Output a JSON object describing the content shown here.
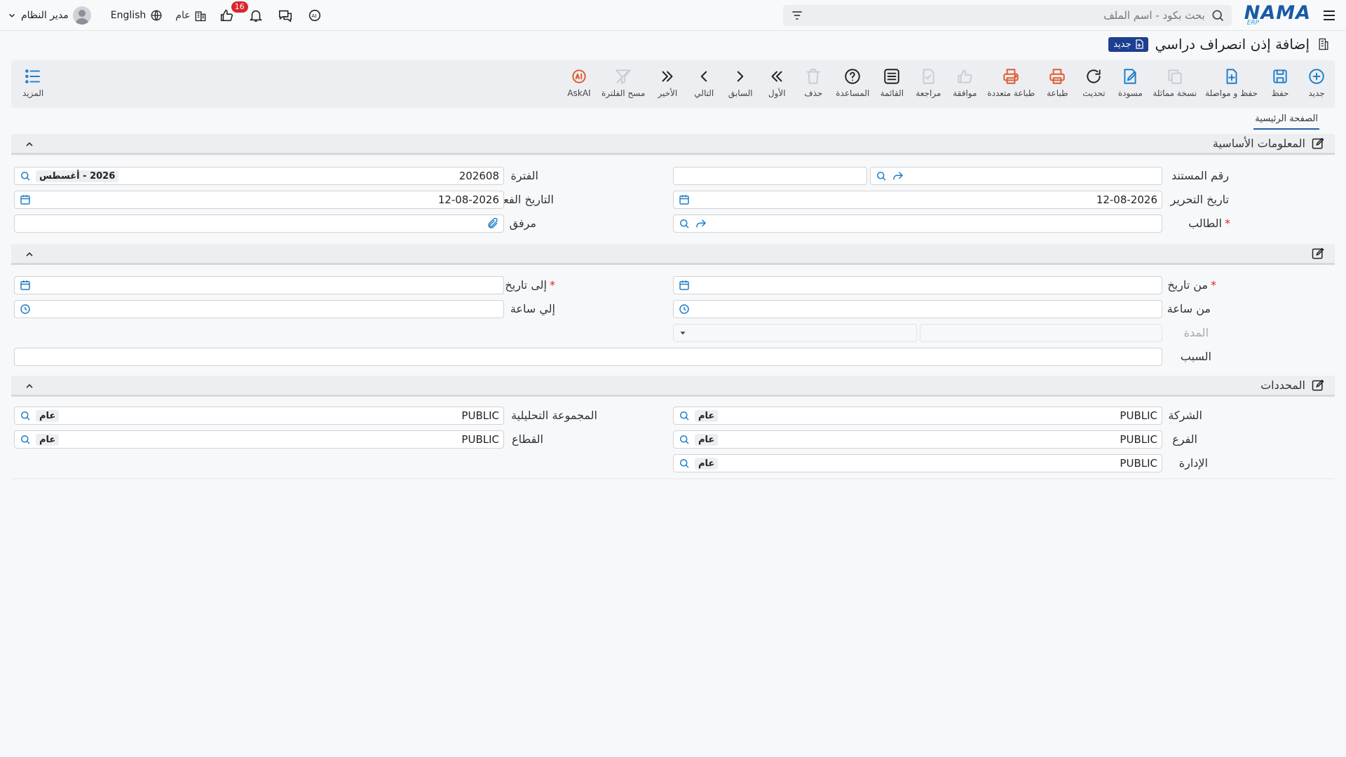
{
  "header": {
    "search_placeholder": "بحث بكود - اسم الملف",
    "logo_main": "NAMA",
    "logo_sub": "ERP",
    "user_name": "مدير النظام",
    "language": "English",
    "scope_label": "عام",
    "notification_count": "16"
  },
  "page": {
    "title": "إضافة إذن انصراف دراسي",
    "status_badge": "جديد"
  },
  "toolbar": {
    "items": [
      {
        "label": "جديد",
        "icon": "plus-circle-icon",
        "enabled": true
      },
      {
        "label": "حفظ",
        "icon": "save-icon",
        "enabled": true
      },
      {
        "label": "حفظ و مواصلة",
        "icon": "save-continue-icon",
        "enabled": true
      },
      {
        "label": "نسخة مماثلة",
        "icon": "copy-icon",
        "enabled": false
      },
      {
        "label": "مسودة",
        "icon": "draft-icon",
        "enabled": true
      },
      {
        "label": "تحديث",
        "icon": "refresh-icon",
        "enabled": true
      },
      {
        "label": "طباعة",
        "icon": "print-icon",
        "enabled": true
      },
      {
        "label": "طباعة متعددة",
        "icon": "multi-print-icon",
        "enabled": true
      },
      {
        "label": "موافقة",
        "icon": "thumbs-up-icon",
        "enabled": false
      },
      {
        "label": "مراجعة",
        "icon": "review-icon",
        "enabled": false
      },
      {
        "label": "القائمة",
        "icon": "list-icon",
        "enabled": true
      },
      {
        "label": "المساعدة",
        "icon": "help-icon",
        "enabled": true
      },
      {
        "label": "حذف",
        "icon": "trash-icon",
        "enabled": false
      },
      {
        "label": "الأول",
        "icon": "first-icon",
        "enabled": true
      },
      {
        "label": "السابق",
        "icon": "previous-icon",
        "enabled": true
      },
      {
        "label": "التالي",
        "icon": "next-icon",
        "enabled": true
      },
      {
        "label": "الأخير",
        "icon": "last-icon",
        "enabled": true
      },
      {
        "label": "مسح الفلترة",
        "icon": "clear-filter-icon",
        "enabled": false
      },
      {
        "label": "AskAI",
        "icon": "ai-icon",
        "enabled": true
      }
    ],
    "more_label": "المزيد"
  },
  "tabs": {
    "main": "الصفحة الرئيسية"
  },
  "basic": {
    "title": "المعلومات الأساسية",
    "doc_number_label": "رقم المستند",
    "doc_number_value": "",
    "period_label": "الفترة",
    "period_value": "202608",
    "period_tag": "2026 - أغسطس",
    "edit_date_label": "تاريخ التحرير",
    "edit_date_value": "12-08-2026",
    "actual_date_label": "التاريخ الفعلي",
    "actual_date_value": "12-08-2026",
    "student_label": "الطالب",
    "attachment_label": "مرفق"
  },
  "timing": {
    "from_date_label": "من تاريخ",
    "to_date_label": "إلى تاريخ",
    "from_time_label": "من ساعة",
    "to_time_label": "إلي ساعة",
    "duration_label": "المدة",
    "reason_label": "السبب"
  },
  "dimensions": {
    "title": "المحددات",
    "company_label": "الشركة",
    "company_value": "PUBLIC",
    "company_tag": "عام",
    "analysis_label": "المجموعة التحليلية",
    "analysis_value": "PUBLIC",
    "analysis_tag": "عام",
    "branch_label": "الفرع",
    "branch_value": "PUBLIC",
    "branch_tag": "عام",
    "sector_label": "القطاع",
    "sector_value": "PUBLIC",
    "sector_tag": "عام",
    "department_label": "الإدارة",
    "department_value": "PUBLIC",
    "department_tag": "عام"
  },
  "colors": {
    "accent": "#1e7ec8",
    "brand": "#1a5aa6",
    "print": "#e05a2b",
    "badge": "#d9262c",
    "status_badge_bg": "#1e3f8f"
  }
}
